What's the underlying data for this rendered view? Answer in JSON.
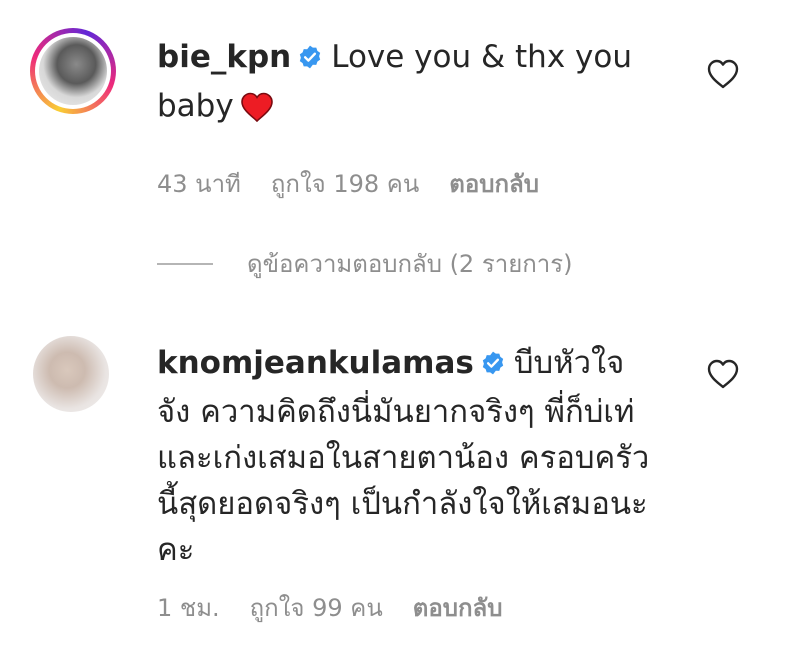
{
  "comments": [
    {
      "username": "bie_kpn",
      "verified": true,
      "text": "Love you & thx you baby",
      "emoji": "red-heart",
      "time": "43 นาที",
      "likes": "ถูกใจ 198 คน",
      "reply_label": "ตอบกลับ",
      "view_replies_label": "ดูข้อความตอบกลับ (2 รายการ)"
    },
    {
      "username": "knomjeankulamas",
      "verified": true,
      "text": "บีบหัวใจจัง ความคิดถึงนี่มันยากจริงๆ พี่ก็บ่เท่และเก่งเสมอในสายตาน้อง ครอบครัวนี้สุดยอดจริงๆ เป็นกำลังใจให้เสมอนะคะ",
      "time": "1 ชม.",
      "likes": "ถูกใจ 99 คน",
      "reply_label": "ตอบกลับ"
    }
  ],
  "colors": {
    "text": "#262626",
    "meta": "#8e8e8e",
    "verified": "#3897f0",
    "heart": "#ed1c24"
  }
}
